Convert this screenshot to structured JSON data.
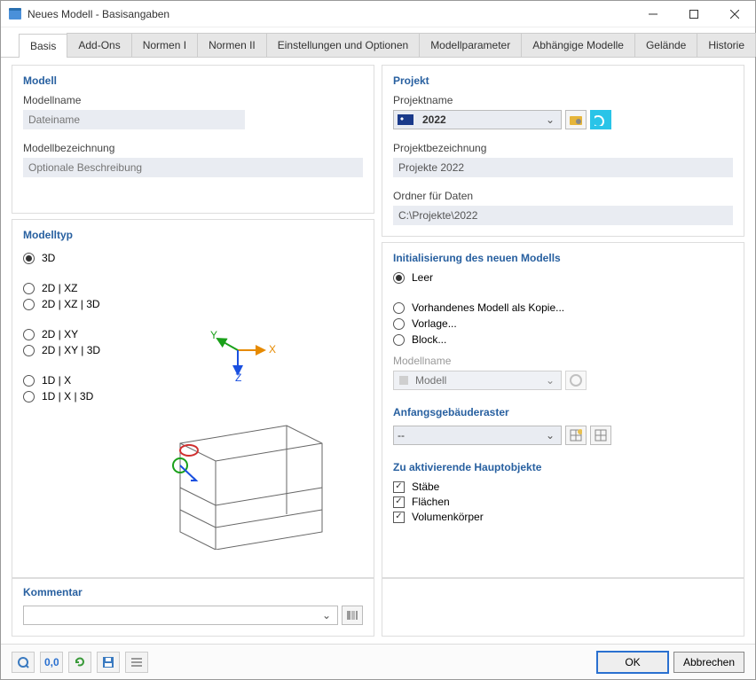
{
  "window": {
    "title": "Neues Modell - Basisangaben"
  },
  "tabs": [
    "Basis",
    "Add-Ons",
    "Normen I",
    "Normen II",
    "Einstellungen und Optionen",
    "Modellparameter",
    "Abhängige Modelle",
    "Gelände",
    "Historie"
  ],
  "modell": {
    "heading": "Modell",
    "name_label": "Modellname",
    "name_placeholder": "Dateiname",
    "desc_label": "Modellbezeichnung",
    "desc_placeholder": "Optionale Beschreibung"
  },
  "modelltyp": {
    "heading": "Modelltyp",
    "options": [
      "3D",
      "2D | XZ",
      "2D | XZ | 3D",
      "2D | XY",
      "2D | XY | 3D",
      "1D | X",
      "1D | X | 3D"
    ],
    "selected": "3D"
  },
  "kommentar": {
    "heading": "Kommentar"
  },
  "projekt": {
    "heading": "Projekt",
    "name_label": "Projektname",
    "name_value": "2022",
    "desc_label": "Projektbezeichnung",
    "desc_value": "Projekte 2022",
    "folder_label": "Ordner für Daten",
    "folder_value": "C:\\Projekte\\2022"
  },
  "init": {
    "heading": "Initialisierung des neuen Modells",
    "options": [
      "Leer",
      "Vorhandenes Modell als Kopie...",
      "Vorlage...",
      "Block..."
    ],
    "selected": "Leer",
    "copy_label": "Modellname",
    "copy_value": "Modell"
  },
  "raster": {
    "heading": "Anfangsgebäuderaster",
    "value": "--"
  },
  "hauptobjekte": {
    "heading": "Zu aktivierende Hauptobjekte",
    "items": [
      {
        "label": "Stäbe",
        "checked": true
      },
      {
        "label": "Flächen",
        "checked": true
      },
      {
        "label": "Volumenkörper",
        "checked": true
      }
    ]
  },
  "footer": {
    "ok": "OK",
    "cancel": "Abbrechen"
  }
}
